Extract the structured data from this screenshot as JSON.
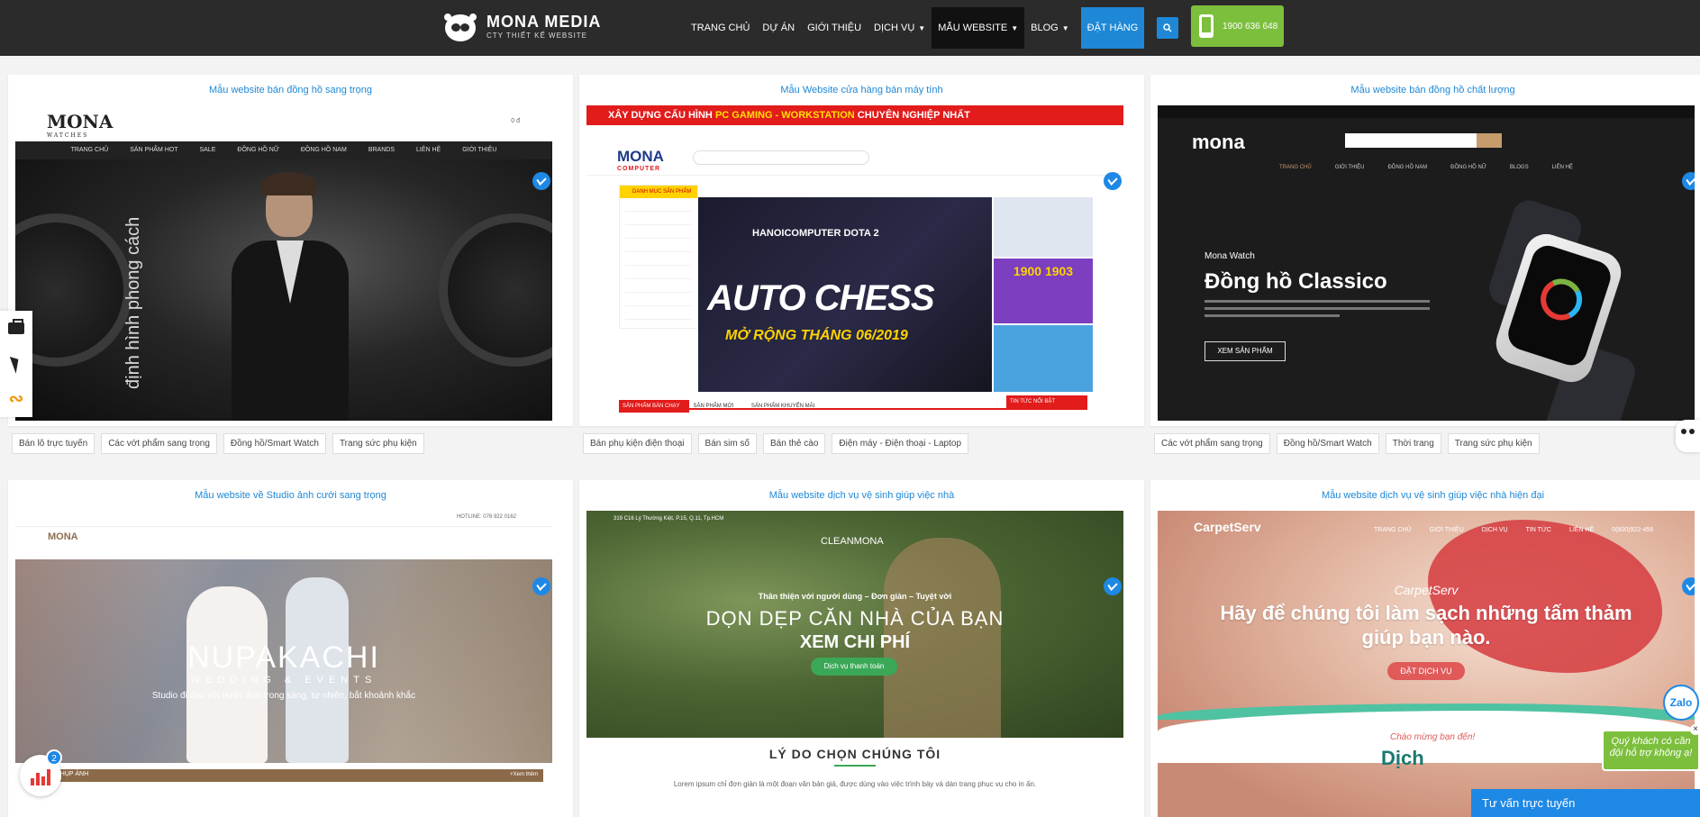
{
  "header": {
    "logo_title": "MONA MEDIA",
    "logo_sub": "CTY THIẾT KẾ WEBSITE",
    "nav": [
      {
        "label": "TRANG CHỦ",
        "dropdown": false
      },
      {
        "label": "DỰ ÁN",
        "dropdown": false
      },
      {
        "label": "GIỚI THIỆU",
        "dropdown": false
      },
      {
        "label": "DỊCH VỤ",
        "dropdown": true
      },
      {
        "label": "MẪU WEBSITE",
        "dropdown": true,
        "active": true
      },
      {
        "label": "BLOG",
        "dropdown": true
      }
    ],
    "order_label": "ĐẶT HÀNG",
    "hotline": "1900 636 648",
    "colors": {
      "bar": "#2b2b2b",
      "accent": "#1e88d6",
      "hotline": "#7cbf3d"
    }
  },
  "cards": [
    {
      "title": "Mẫu website bán đồng hồ sang trọng",
      "preview": {
        "logo": "MONA",
        "logo_sub": "WATCHES",
        "menu": [
          "TRANG CHỦ",
          "SẢN PHẨM HOT",
          "SALE",
          "ĐỒNG HỒ NỮ",
          "ĐỒNG HỒ NAM",
          "BRANDS",
          "LIÊN HỆ",
          "GIỚI THIỆU"
        ],
        "cart": "0 đ",
        "hero_text": "định hình phong cách"
      },
      "tags": [
        "Bán lô trực tuyến",
        "Các vớt phẩm sang trọng",
        "Đồng hồ/Smart Watch",
        "Trang sức phụ kiện"
      ]
    },
    {
      "title": "Mẫu Website cửa hàng bán máy tính",
      "preview": {
        "banner_a": "XÂY DỰNG CẤU HÌNH ",
        "banner_b": "PC GAMING - WORKSTATION",
        "banner_c": " CHUYÊN NGHIỆP NHẤT",
        "logo": "MONA",
        "logo_sub": "COMPUTER",
        "slide_title": "HANOICOMPUTER DOTA 2",
        "slide_big": "AUTO CHESS",
        "slide_sub": "MỞ RỘNG THÁNG 06/2019",
        "hotline_ad": "1900 1903",
        "tab_label": "SẢN PHẨM BÁN CHẠY",
        "tab2": "SẢN PHẨM MỚI",
        "tab3": "SẢN PHẨM KHUYẾN MÃI",
        "news": "TIN TỨC NỔI BẬT",
        "category": "DANH MỤC SẢN PHẨM"
      },
      "tags": [
        "Bán phụ kiện điện thoại",
        "Bán sim số",
        "Bán thẻ cào",
        "Điện máy - Điện thoại - Laptop"
      ]
    },
    {
      "title": "Mẫu website bán đồng hồ chất lượng",
      "preview": {
        "logo": "mona",
        "menu": [
          "TRANG CHỦ",
          "GIỚI THIỆU",
          "ĐỒNG HỒ NAM",
          "ĐỒNG HỒ NỮ",
          "BLOGS",
          "LIÊN HỆ"
        ],
        "brand": "Mona Watch",
        "heading": "Đồng hồ Classico",
        "button": "XEM SẢN PHẨM"
      },
      "tags": [
        "Các vớt phẩm sang trọng",
        "Đồng hồ/Smart Watch",
        "Thời trang",
        "Trang sức phụ kiện"
      ]
    },
    {
      "title": "Mẫu website về Studio ảnh cưới sang trọng",
      "preview": {
        "logo": "MONA",
        "hotline": "HOTLINE: 076 922 0162",
        "headline": "NUPAKACHI",
        "sub": "WEDDING & EVENTS",
        "caption": "Studio đi đầu với nước ảnh trong sáng, tự nhiên, bắt khoảnh khắc",
        "strip": "DỊCH VỤ CHỤP ẢNH",
        "more": "+Xem thêm"
      }
    },
    {
      "title": "Mẫu website dịch vụ vệ sinh giúp việc nhà",
      "preview": {
        "logo": "CLEANMONA",
        "address": "319 C16 Lý Thường Kiệt, P.15, Q.11, Tp.HCM",
        "tagline": "Thân thiện với người dùng – Đơn giản – Tuyệt vời",
        "headline": "DỌN DẸP CĂN NHÀ CỦA BẠN",
        "headline2": "XEM CHI PHÍ",
        "button": "Dịch vụ thanh toán",
        "section": "LÝ DO CHỌN CHÚNG TÔI",
        "lorem": "Lorem ipsum chỉ đơn giản là một đoạn văn bản giả, được dùng vào việc trình bày và dàn trang phục vụ cho in ấn."
      }
    },
    {
      "title": "Mẫu website dịch vụ vệ sinh giúp việc nhà hiện đại",
      "preview": {
        "logo": "CarpetServ",
        "menu": [
          "TRANG CHỦ",
          "GIỚI THIỆU",
          "DỊCH VỤ",
          "TIN TỨC",
          "LIÊN HỆ"
        ],
        "phone": "0(800)922-456",
        "script": "CarpetServ",
        "headline": "Hãy để chúng tôi làm sạch những tấm thảm giúp bạn nào.",
        "button": "ĐẶT DỊCH VỤ",
        "welcome": "Chào mừng bạn đến!",
        "dic": "Dịch"
      }
    }
  ],
  "widgets": {
    "badge_count": "2",
    "zalo": "Zalo",
    "speech": "Quý khách có cần đội hỗ trợ không ạ!",
    "close": "×",
    "chat_bar": "Tư vấn trực tuyến"
  }
}
